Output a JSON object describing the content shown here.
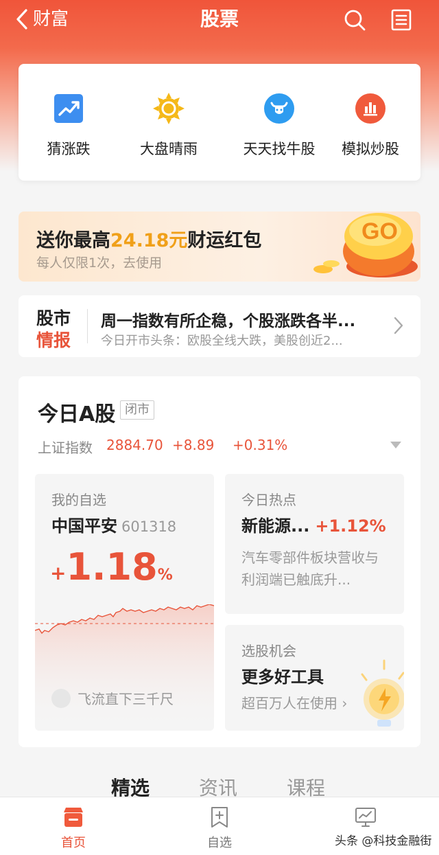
{
  "header": {
    "back_label": "财富",
    "title": "股票"
  },
  "tools": [
    {
      "label": "猜涨跌",
      "icon": "trend-up-icon"
    },
    {
      "label": "大盘晴雨",
      "icon": "sun-icon"
    },
    {
      "label": "天天找牛股",
      "icon": "bull-icon"
    },
    {
      "label": "模拟炒股",
      "icon": "bar-chart-icon"
    }
  ],
  "promo": {
    "prefix": "送你最高",
    "amount": "24.18元",
    "suffix": "财运红包",
    "subtitle": "每人仅限1次，去使用",
    "button": "GO"
  },
  "news": {
    "badge_top": "股市",
    "badge_bottom": "情报",
    "headline": "周一指数有所企稳，个股涨跌各半...",
    "summary": "今日开市头条：欧股全线大跌，美股创近2..."
  },
  "market": {
    "title": "今日A股",
    "status": "闭市",
    "index_name": "上证指数",
    "index_value": "2884.70",
    "index_change": "+8.89",
    "index_pct": "+0.31%",
    "watchlist": {
      "caption": "我的自选",
      "stock_name": "中国平安",
      "stock_code": "601318",
      "sign": "+",
      "pct": "1.18",
      "pct_unit": "%",
      "user": "飞流直下三千尺"
    },
    "hot": {
      "caption": "今日热点",
      "topic": "新能源...",
      "pct": "+1.12%",
      "desc": "汽车零部件板块营收与利润端已触底升..."
    },
    "pick": {
      "caption": "选股机会",
      "title": "更多好工具",
      "desc": "超百万人在使用"
    }
  },
  "content_tabs": [
    "精选",
    "资讯",
    "课程"
  ],
  "bottom_nav": [
    {
      "label": "首页",
      "icon": "home-store-icon",
      "active": true
    },
    {
      "label": "自选",
      "icon": "add-bookmark-icon",
      "active": false
    },
    {
      "label": "",
      "icon": "monitor-chart-icon",
      "active": false
    }
  ],
  "watermark": "头条 @科技金融街",
  "colors": {
    "accent": "#f0553a",
    "up": "#e8543a",
    "gold": "#f0a019"
  }
}
